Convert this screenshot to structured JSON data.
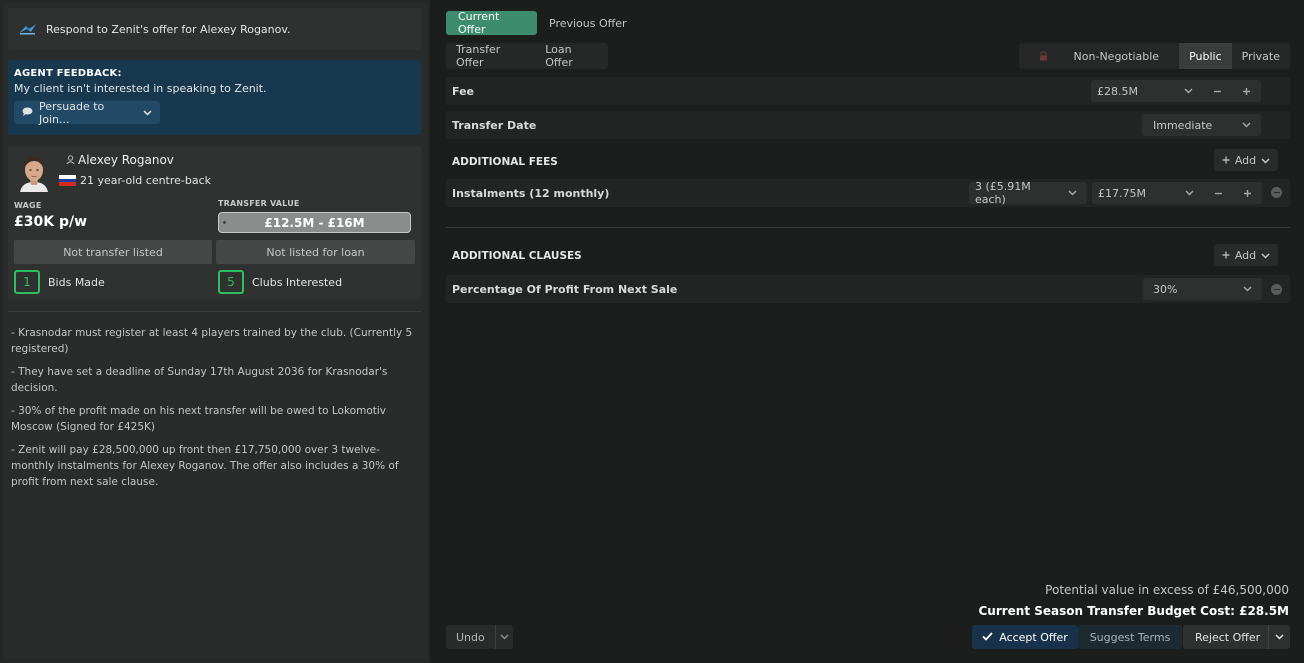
{
  "colors": {
    "accent_green": "#3d8c6e",
    "agent_blue": "#17384f",
    "stat_green": "#2ebd5f",
    "accept_blue": "#17324a"
  },
  "notice": {
    "icon": "zenit-logo",
    "text": "Respond to Zenit's offer for Alexey Roganov."
  },
  "agent": {
    "title": "AGENT FEEDBACK:",
    "message": "My client isn't interested in speaking to Zenit.",
    "action_label": "Persuade to Join..."
  },
  "player": {
    "name": "Alexey Roganov",
    "description": "21 year-old centre-back",
    "wage_label": "WAGE",
    "wage": "£30K p/w",
    "transfer_value_label": "TRANSFER VALUE",
    "transfer_value": "£12.5M - £16M",
    "transfer_status": "Not transfer listed",
    "loan_status": "Not listed for loan",
    "bids_count": "1",
    "bids_label": "Bids Made",
    "clubs_count": "5",
    "clubs_label": "Clubs Interested"
  },
  "notes": [
    "- Krasnodar must register at least 4 players trained by the club. (Currently 5 registered)",
    "- They have set a deadline of Sunday 17th August 2036 for Krasnodar's decision.",
    "- 30% of the profit made on his next transfer will be owed to Lokomotiv Moscow (Signed for £425K)",
    "- Zenit will pay £28,500,000 up front then £17,750,000 over 3 twelve-monthly instalments for Alexey Roganov. The offer also includes a 30% of profit from next sale clause."
  ],
  "offer_tabs": {
    "current": "Current Offer",
    "previous": "Previous Offer"
  },
  "offer_type_tabs": {
    "transfer": "Transfer Offer",
    "loan": "Loan Offer"
  },
  "visibility": {
    "non_negotiable": "Non-Negotiable",
    "public": "Public",
    "private": "Private"
  },
  "fee": {
    "label": "Fee",
    "value": "£28.5M"
  },
  "transfer_date": {
    "label": "Transfer Date",
    "value": "Immediate"
  },
  "additional_fees": {
    "title": "ADDITIONAL FEES",
    "add_label": "Add",
    "instalments_label": "Instalments (12 monthly)",
    "instalments_count": "3 (£5.91M each)",
    "instalments_value": "£17.75M"
  },
  "additional_clauses": {
    "title": "ADDITIONAL CLAUSES",
    "add_label": "Add",
    "profit_label": "Percentage Of Profit From Next Sale",
    "profit_value": "30%"
  },
  "summary": {
    "potential": "Potential value in excess of £46,500,000",
    "budget": "Current Season Transfer Budget Cost: £28.5M"
  },
  "actions": {
    "undo": "Undo",
    "accept": "Accept Offer",
    "suggest": "Suggest Terms",
    "reject": "Reject Offer"
  }
}
